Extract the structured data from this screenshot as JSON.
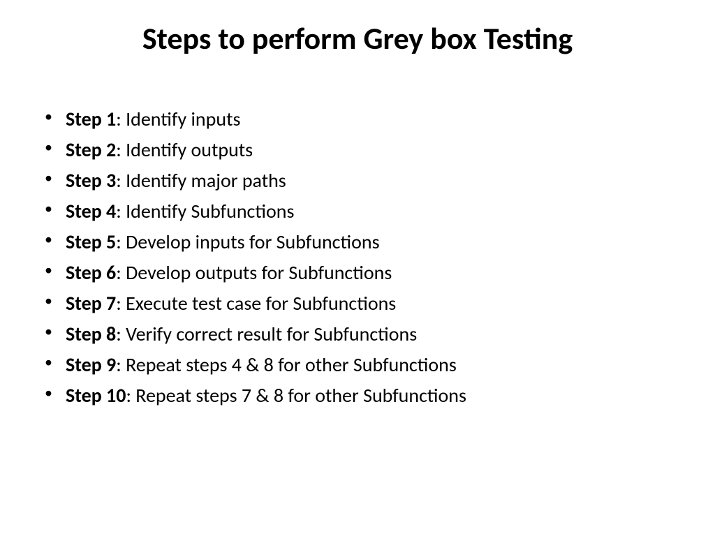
{
  "title": "Steps to perform Grey box Testing",
  "steps": [
    {
      "label": "Step 1",
      "text": ": Identify inputs"
    },
    {
      "label": "Step 2",
      "text": ": Identify outputs"
    },
    {
      "label": "Step 3",
      "text": ": Identify major paths"
    },
    {
      "label": "Step 4",
      "text": ": Identify Subfunctions"
    },
    {
      "label": "Step 5",
      "text": ": Develop inputs for Subfunctions"
    },
    {
      "label": "Step 6",
      "text": ": Develop outputs for Subfunctions"
    },
    {
      "label": "Step 7",
      "text": ": Execute test case for Subfunctions"
    },
    {
      "label": "Step 8",
      "text": ": Verify correct result for Subfunctions"
    },
    {
      "label": "Step 9",
      "text": ": Repeat steps 4 & 8 for other Subfunctions"
    },
    {
      "label": "Step 10",
      "text": ": Repeat steps 7 & 8 for other Subfunctions"
    }
  ]
}
